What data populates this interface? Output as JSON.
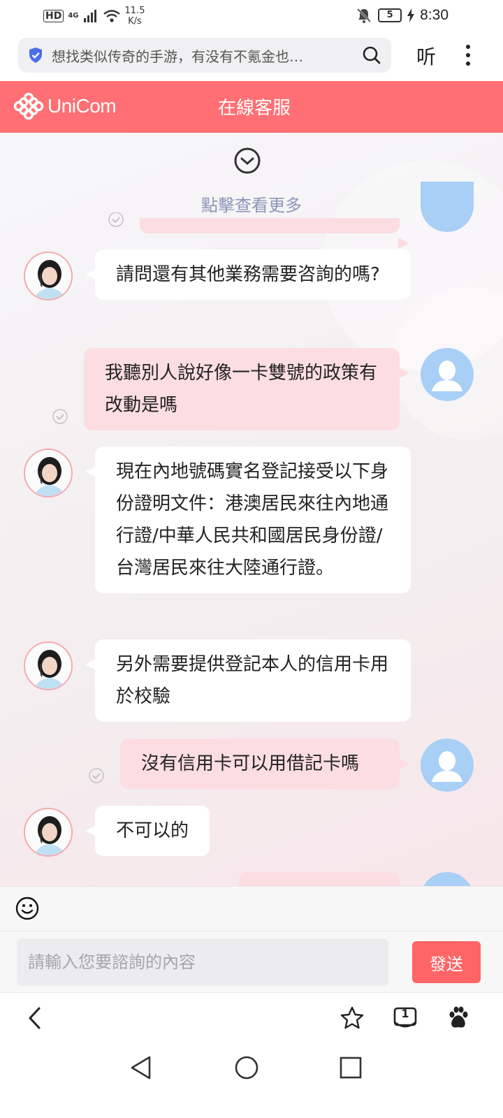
{
  "status_bar": {
    "hd": "HD",
    "network": "4G",
    "speed_value": "11.5",
    "speed_unit": "K/s",
    "battery": "5",
    "time": "8:30",
    "icons": [
      "signal-icon",
      "wifi-icon",
      "mute-bell-icon",
      "battery-icon",
      "charging-icon"
    ]
  },
  "browser": {
    "search_text": "想找类似传奇的手游，有没有不氪金也…",
    "listen_label": "听"
  },
  "header": {
    "logo_text": "UniCom",
    "title": "在線客服",
    "accent_color": "#ff6f73"
  },
  "chat": {
    "see_more": "點擊查看更多",
    "messages": [
      {
        "sender": "agent",
        "text": "請問還有其他業務需要咨詢的嗎?"
      },
      {
        "sender": "user",
        "text": "我聽別人說好像一卡雙號的政策有改動是嗎"
      },
      {
        "sender": "agent",
        "text": "現在內地號碼實名登記接受以下身份證明文件：港澳居民來往內地通行證/中華人民共和國居民身份證/台灣居民來往大陸通行證。"
      },
      {
        "sender": "agent",
        "text": "另外需要提供登記本人的信用卡用於校驗"
      },
      {
        "sender": "user",
        "text": "沒有信用卡可以用借記卡嗎"
      },
      {
        "sender": "agent",
        "text": "不可以的"
      }
    ]
  },
  "input": {
    "placeholder": "請輸入您要諮詢的內容",
    "send_label": "發送"
  },
  "browser_bottom": {
    "tab_count": "1",
    "icons": [
      "back-icon",
      "star-icon",
      "tabs-icon",
      "baidu-paw-icon"
    ]
  },
  "system_nav": {
    "icons": [
      "nav-back-icon",
      "nav-home-icon",
      "nav-recents-icon"
    ]
  }
}
